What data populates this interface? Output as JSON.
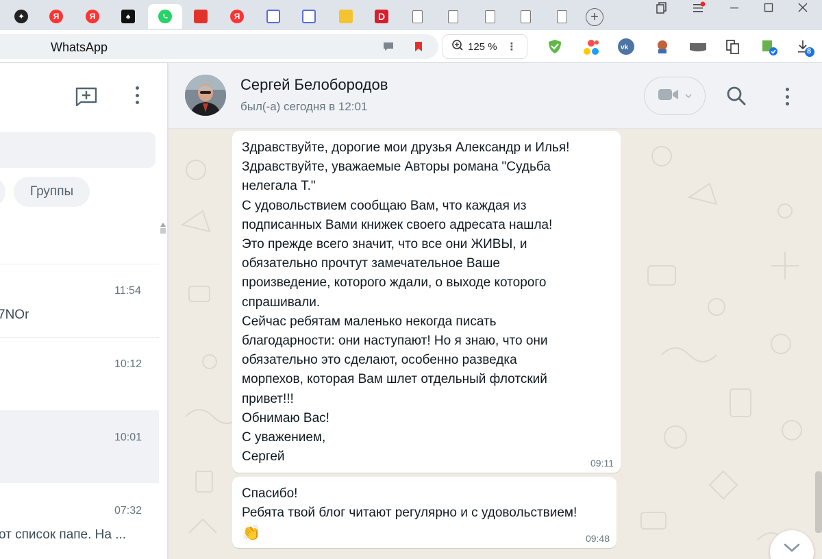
{
  "browser": {
    "tabs": [
      {
        "icon": "dark-star-icon",
        "letter": ""
      },
      {
        "icon": "yandex-icon",
        "letter": "Я"
      },
      {
        "icon": "yandex-icon",
        "letter": "Я"
      },
      {
        "icon": "spade-icon",
        "letter": "♠"
      },
      {
        "icon": "whatsapp-icon",
        "letter": ""
      },
      {
        "icon": "pdf-icon",
        "letter": ""
      },
      {
        "icon": "yandex-icon",
        "letter": "Я"
      },
      {
        "icon": "calendar-icon",
        "letter": ""
      },
      {
        "icon": "calendar-icon",
        "letter": ""
      },
      {
        "icon": "image-icon",
        "letter": ""
      },
      {
        "icon": "dzen-icon",
        "letter": "D"
      },
      {
        "icon": "document-icon",
        "letter": ""
      },
      {
        "icon": "document-icon",
        "letter": ""
      },
      {
        "icon": "document-icon",
        "letter": ""
      },
      {
        "icon": "document-icon",
        "letter": ""
      },
      {
        "icon": "document-icon",
        "letter": ""
      }
    ],
    "page_title": "WhatsApp",
    "zoom": "125 %",
    "downloads_count": "8"
  },
  "sidebar": {
    "filter_groups": "Группы",
    "chats": [
      {
        "time": "11:54",
        "preview": "7NOr"
      },
      {
        "time": "10:12",
        "preview": ""
      },
      {
        "time": "10:01",
        "preview": ""
      },
      {
        "time": "07:32",
        "preview": "от  список папе. На ..."
      }
    ]
  },
  "chat": {
    "contact_name": "Сергей Белобородов",
    "contact_status": "был(-а) сегодня в 12:01",
    "messages": [
      {
        "lines": [
          "Здравствуйте, дорогие мои друзья Александр и Илья!",
          "Здравствуйте, уважаемые Авторы романа \"Судьба",
          "нелегала Т.\"",
          "С удовольствием сообщаю Вам, что каждая из",
          "подписанных Вами книжек своего адресата нашла!",
          "Это прежде всего значит, что все они ЖИВЫ, и",
          "обязательно прочтут замечательное Ваше",
          "произведение, которого ждали, о выходе которого",
          "спрашивали.",
          "Сейчас ребятам маленько некогда писать",
          "благодарности: они наступают! Но я знаю, что они",
          "обязательно это сделают, особенно разведка",
          "морпехов, которая Вам шлет отдельный флотский",
          "привет!!!",
          "Обнимаю Вас!",
          "С уважением,",
          "Сергей"
        ],
        "time": "09:11"
      },
      {
        "lines": [
          "Спасибо!",
          "Ребята твой блог читают регулярно и с удовольствием!"
        ],
        "emoji": "👏",
        "time": "09:48"
      }
    ]
  },
  "colors": {
    "whatsapp_green": "#25d366",
    "chat_bg": "#efeae2",
    "panel_bg": "#f0f2f5",
    "bubble_bg": "#ffffff"
  }
}
